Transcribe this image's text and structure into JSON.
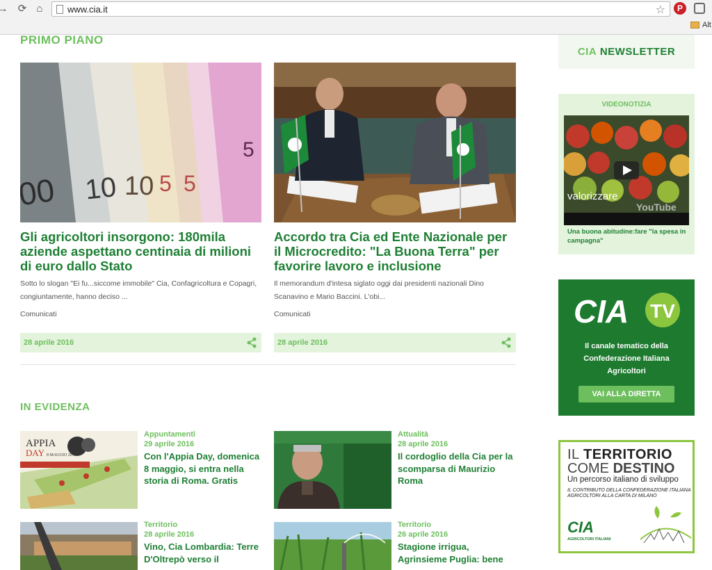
{
  "browser": {
    "url": "www.cia.it",
    "bookmark_label": "Alt"
  },
  "primo_piano": {
    "title": "PRIMO PIANO",
    "articles": [
      {
        "title": "Gli agricoltori insorgono: 180mila aziende aspettano centinaia di milioni di euro dallo Stato",
        "excerpt": "Sotto lo slogan \"Ei fu...siccome immobile\" Cia, Confagricoltura e Copagri, congiuntamente, hanno deciso ...",
        "category": "Comunicati",
        "date": "28 aprile 2016"
      },
      {
        "title": "Accordo tra Cia ed Ente Nazionale per il Microcredito: \"La Buona Terra\" per favorire lavoro e inclusione",
        "excerpt": "Il memorandum d'intesa siglato oggi dai presidenti nazionali Dino Scanavino e Mario Baccini. L'obi...",
        "category": "Comunicati",
        "date": "28 aprile 2016"
      }
    ]
  },
  "in_evidenza": {
    "title": "IN EVIDENZA",
    "items": [
      {
        "category": "Appuntamenti",
        "date": "29 aprile 2016",
        "title": "Con l'Appia Day, domenica 8 maggio, si entra nella storia di Roma. Gratis",
        "img_text_1": "APPIA",
        "img_text_2": "DAY",
        "img_text_3": "8 MAGGIO 2016"
      },
      {
        "category": "Attualità",
        "date": "28 aprile 2016",
        "title": "Il cordoglio della Cia per la scomparsa di Maurizio Roma"
      },
      {
        "category": "Territorio",
        "date": "28 aprile 2016",
        "title": "Vino, Cia Lombardia: Terre D'Oltrepò verso il"
      },
      {
        "category": "Territorio",
        "date": "26 aprile 2016",
        "title": "Stagione irrigua, Agrinsieme Puglia: bene"
      }
    ]
  },
  "sidebar": {
    "newsletter_prefix": "CIA",
    "newsletter_label": "NEWSLETTER",
    "video": {
      "label": "VIDEONOTIZIA",
      "overlay": "valorizzare",
      "yt": "YouTube",
      "caption": "Una buona abitudine:fare \"la spesa in campagna\""
    },
    "tv": {
      "logo": "CIA",
      "logo_tv": "TV",
      "text": "Il canale tematico della Confederazione Italiana Agricoltori",
      "button": "VAI ALLA DIRETTA"
    },
    "territorio": {
      "line1_a": "IL",
      "line1_b": "TERRITORIO",
      "line2_a": "COME",
      "line2_b": "DESTINO",
      "line3": "Un percorso italiano di sviluppo",
      "line4": "IL CONTRIBUTO DELLA CONFEDERAZIONE ITALIANA AGRICOLTORI ALLA CARTA DI MILANO",
      "logo": "CIA",
      "logo_sub": "AGRICOLTORI ITALIANI"
    }
  },
  "colors": {
    "green_dark": "#1e7f34",
    "green_light": "#6dbf5e",
    "green_bg": "#e3f3dc",
    "tv_bg": "#1d7a2f"
  }
}
